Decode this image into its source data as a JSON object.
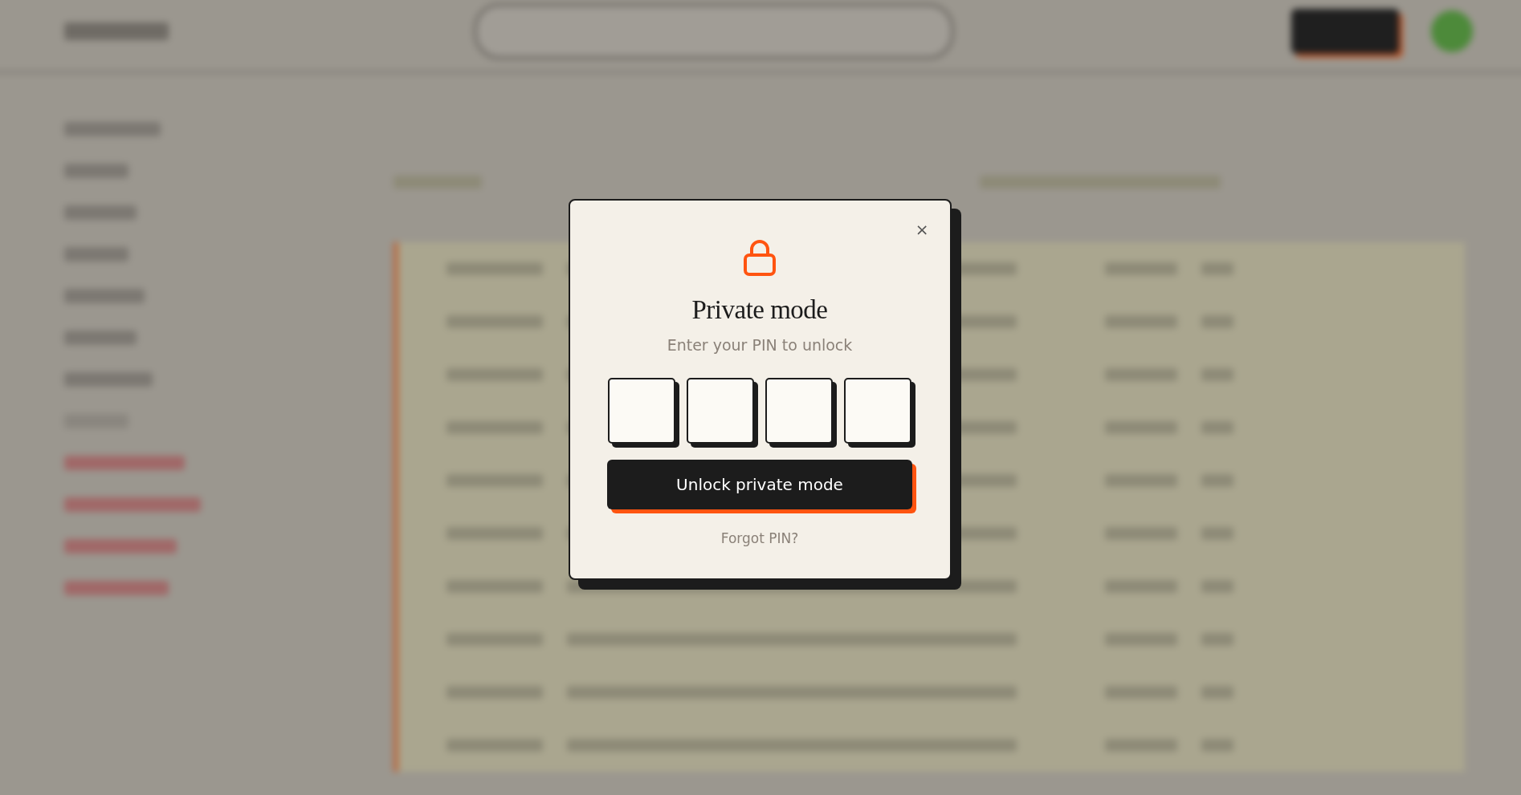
{
  "dialog": {
    "close": "×",
    "title": "Private mode",
    "subtitle": "Enter your PIN to unlock",
    "pin_fields": [
      {
        "filled": false
      },
      {
        "filled": false
      },
      {
        "filled": false
      },
      {
        "filled": false
      }
    ],
    "submit": "Unlock private mode",
    "forgot_link": "Forgot PIN?"
  }
}
